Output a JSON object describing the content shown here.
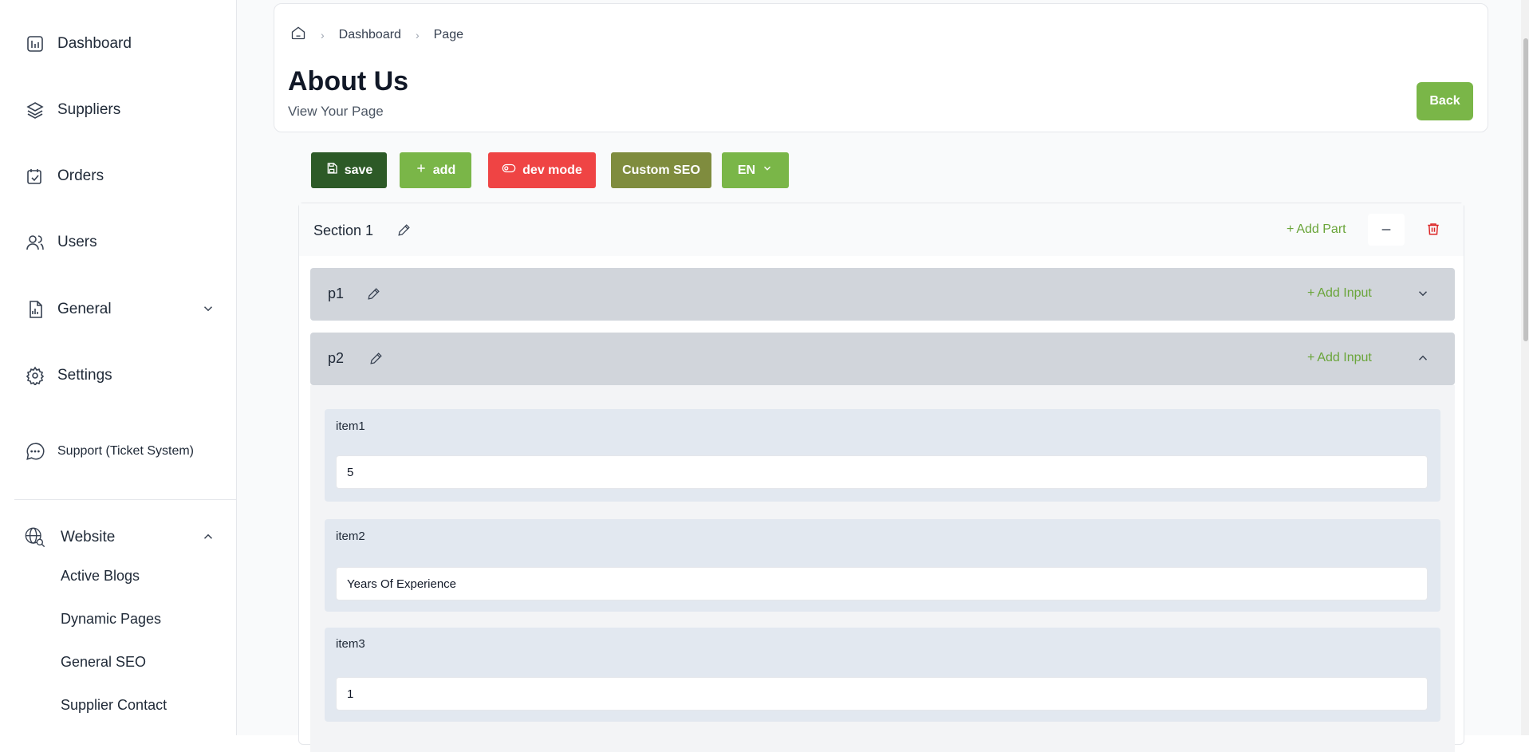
{
  "sidebar": {
    "items": [
      {
        "label": "Dashboard",
        "icon": "chart-icon"
      },
      {
        "label": "Suppliers",
        "icon": "layers-icon"
      },
      {
        "label": "Orders",
        "icon": "calendar-check-icon"
      },
      {
        "label": "Users",
        "icon": "users-icon"
      },
      {
        "label": "General",
        "icon": "document-chart-icon"
      },
      {
        "label": "Settings",
        "icon": "gear-icon"
      },
      {
        "label": "Support (Ticket System)",
        "icon": "chat-icon"
      }
    ],
    "website": {
      "label": "Website",
      "icon": "globe-search-icon",
      "sub_items": [
        "Active Blogs",
        "Dynamic Pages",
        "General SEO",
        "Supplier Contact"
      ]
    }
  },
  "header": {
    "breadcrumb": [
      "Dashboard",
      "Page"
    ],
    "title": "About Us",
    "subtitle": "View Your Page",
    "back_label": "Back"
  },
  "toolbar": {
    "save_label": "save",
    "add_label": "add",
    "dev_mode_label": "dev mode",
    "custom_seo_label": "Custom SEO",
    "language": "EN"
  },
  "section": {
    "title": "Section 1",
    "add_part_label": "Add Part",
    "parts": [
      {
        "name": "p1",
        "add_input_label": "Add Input"
      },
      {
        "name": "p2",
        "add_input_label": "Add Input"
      }
    ],
    "items": [
      {
        "label": "item1",
        "value": "5"
      },
      {
        "label": "item2",
        "value": "Years Of Experience"
      },
      {
        "label": "item3",
        "value": "1"
      }
    ]
  },
  "colors": {
    "accent_green": "#7ab648",
    "save_dark_green": "#2d5a27",
    "dev_mode_red": "#ef4444",
    "custom_seo_olive": "#7f8c3e",
    "trash_red": "#dc2626"
  }
}
